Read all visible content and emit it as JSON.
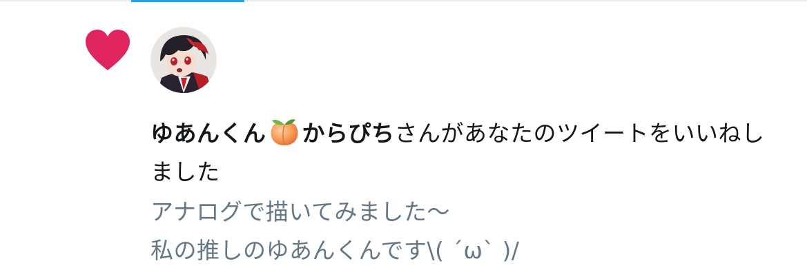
{
  "colors": {
    "heart": "#e0245e",
    "accent": "#1da1f2",
    "primary_text": "#14171a",
    "secondary_text": "#657786",
    "divider": "#e6ecf0"
  },
  "icons": {
    "notification_type": "heart-icon",
    "name_emoji": "peach-emoji"
  },
  "notification": {
    "user_name_part1": "ゆあんくん",
    "user_name_part2": "からぴち",
    "action_text": "さんがあなたのツイートをいいねしました"
  },
  "tweet_preview": {
    "line1": "アナログで描いてみました〜",
    "line2": "私の推しのゆあんくんです\\( ´ω` )/"
  }
}
